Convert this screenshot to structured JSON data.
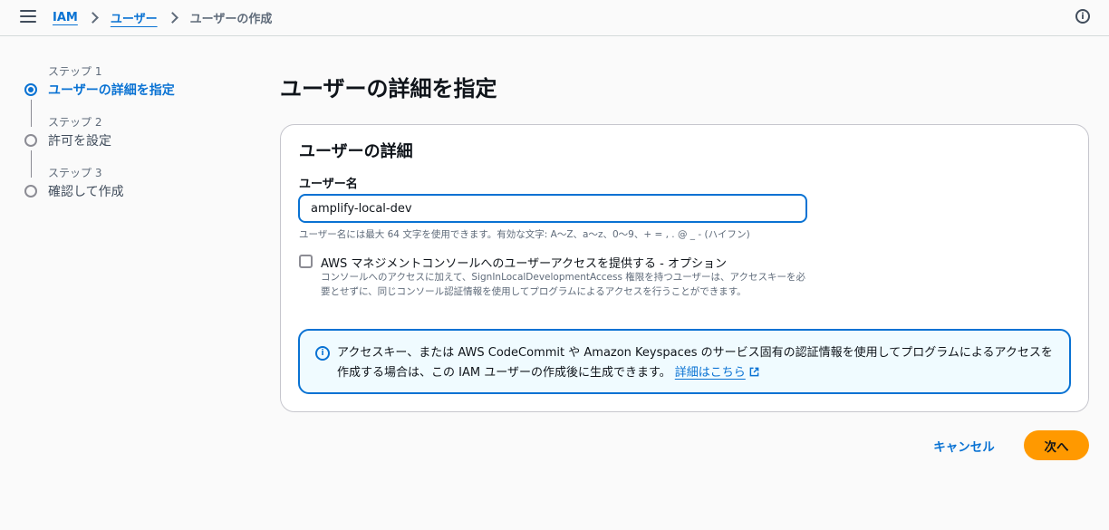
{
  "header": {
    "breadcrumbs": [
      "IAM",
      "ユーザー"
    ],
    "current": "ユーザーの作成",
    "info_icon": "info-icon"
  },
  "steps": [
    {
      "label": "ステップ 1",
      "title": "ユーザーの詳細を指定",
      "active": true
    },
    {
      "label": "ステップ 2",
      "title": "許可を設定",
      "active": false
    },
    {
      "label": "ステップ 3",
      "title": "確認して作成",
      "active": false
    }
  ],
  "main": {
    "page_title": "ユーザーの詳細を指定",
    "card_title": "ユーザーの詳細",
    "username_label": "ユーザー名",
    "username_value": "amplify-local-dev",
    "username_constraint": "ユーザー名には最大 64 文字を使用できます。有効な文字: A〜Z、a〜z、0〜9、+ = , . @ _ - (ハイフン)",
    "console_access_label": "AWS マネジメントコンソールへのユーザーアクセスを提供する - オプション",
    "console_access_checked": false,
    "console_access_desc": "コンソールへのアクセスに加えて、SignInLocalDevelopmentAccess 権限を持つユーザーは、アクセスキーを必要とせずに、同じコンソール認証情報を使用してプログラムによるアクセスを行うことができます。",
    "alert_text": "アクセスキー、または AWS CodeCommit や Amazon Keyspaces のサービス固有の認証情報を使用してプログラムによるアクセスを作成する場合は、この IAM ユーザーの作成後に生成できます。",
    "alert_link": "詳細はこちら"
  },
  "actions": {
    "cancel": "キャンセル",
    "next": "次へ"
  },
  "colors": {
    "accent": "#0972d3",
    "primary_button": "#ff9900"
  }
}
